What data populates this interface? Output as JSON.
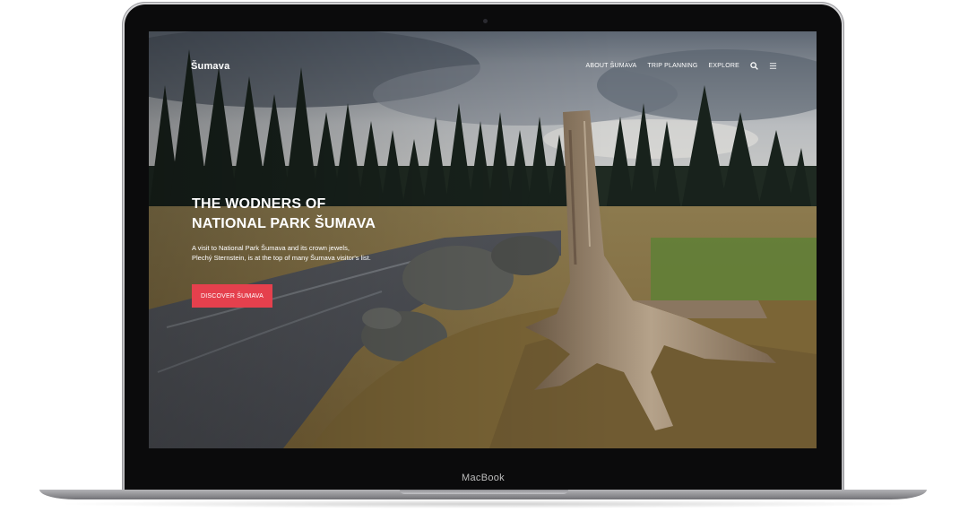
{
  "device": {
    "brand_label": "MacBook"
  },
  "site": {
    "logo": "Šumava",
    "nav": {
      "items": [
        {
          "label": "ABOUT ŠUMAVA"
        },
        {
          "label": "TRIP PLANNING"
        },
        {
          "label": "EXPLORE"
        }
      ],
      "search_icon": "search-icon",
      "menu_icon": "hamburger-menu-icon"
    },
    "hero": {
      "title_line1": "THE WODNERS OF",
      "title_line2": "NATIONAL PARK ŠUMAVA",
      "description": "A visit to National Park Šumava and its crown jewels, Plechý Sternstein, is at the top of many Šumava visitor's list.",
      "cta_label": "DISCOVER ŠUMAVA"
    },
    "colors": {
      "accent": "#e5404d",
      "text": "#ffffff"
    }
  }
}
